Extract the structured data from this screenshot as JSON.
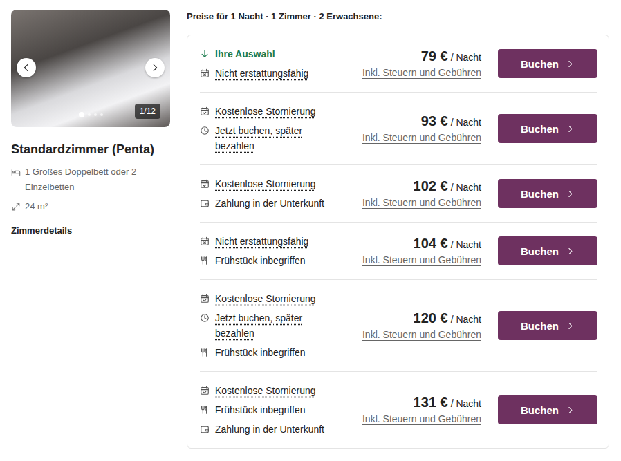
{
  "header": "Preise für 1 Nacht · 1 Zimmer · 2 Erwachsene:",
  "room": {
    "photo_counter": "1/12",
    "photo_dots": [
      {
        "selected": true
      },
      {
        "selected": false
      },
      {
        "selected": false
      },
      {
        "selected": false
      }
    ],
    "title": "Standardzimmer (Penta)",
    "bed": "1 Großes Doppelbett oder 2 Einzelbetten",
    "size": "24 m²",
    "details_link": "Zimmerdetails"
  },
  "selection_label": "Ihre Auswahl",
  "offers": [
    {
      "selected": true,
      "features": [
        {
          "kind": "nonrefundable",
          "text": "Nicht erstattungsfähig"
        }
      ],
      "price": "79 €",
      "per": "/ Nacht",
      "taxes": "Inkl. Steuern und Gebühren",
      "button": "Buchen"
    },
    {
      "selected": false,
      "features": [
        {
          "kind": "cancellation",
          "text": "Kostenlose Stornierung"
        },
        {
          "kind": "paylater",
          "text": "Jetzt buchen, später bezahlen"
        }
      ],
      "price": "93 €",
      "per": "/ Nacht",
      "taxes": "Inkl. Steuern und Gebühren",
      "button": "Buchen"
    },
    {
      "selected": false,
      "features": [
        {
          "kind": "cancellation",
          "text": "Kostenlose Stornierung"
        },
        {
          "kind": "payatproperty",
          "text": "Zahlung in der Unterkunft"
        }
      ],
      "price": "102 €",
      "per": "/ Nacht",
      "taxes": "Inkl. Steuern und Gebühren",
      "button": "Buchen"
    },
    {
      "selected": false,
      "features": [
        {
          "kind": "nonrefundable",
          "text": "Nicht erstattungsfähig"
        },
        {
          "kind": "breakfast",
          "text": "Frühstück inbegriffen"
        }
      ],
      "price": "104 €",
      "per": "/ Nacht",
      "taxes": "Inkl. Steuern und Gebühren",
      "button": "Buchen"
    },
    {
      "selected": false,
      "features": [
        {
          "kind": "cancellation",
          "text": "Kostenlose Stornierung"
        },
        {
          "kind": "paylater",
          "text": "Jetzt buchen, später bezahlen"
        },
        {
          "kind": "breakfast",
          "text": "Frühstück inbegriffen"
        }
      ],
      "price": "120 €",
      "per": "/ Nacht",
      "taxes": "Inkl. Steuern und Gebühren",
      "button": "Buchen"
    },
    {
      "selected": false,
      "features": [
        {
          "kind": "cancellation",
          "text": "Kostenlose Stornierung"
        },
        {
          "kind": "breakfast",
          "text": "Frühstück inbegriffen"
        },
        {
          "kind": "payatproperty",
          "text": "Zahlung in der Unterkunft"
        }
      ],
      "price": "131 €",
      "per": "/ Nacht",
      "taxes": "Inkl. Steuern und Gebühren",
      "button": "Buchen"
    }
  ]
}
